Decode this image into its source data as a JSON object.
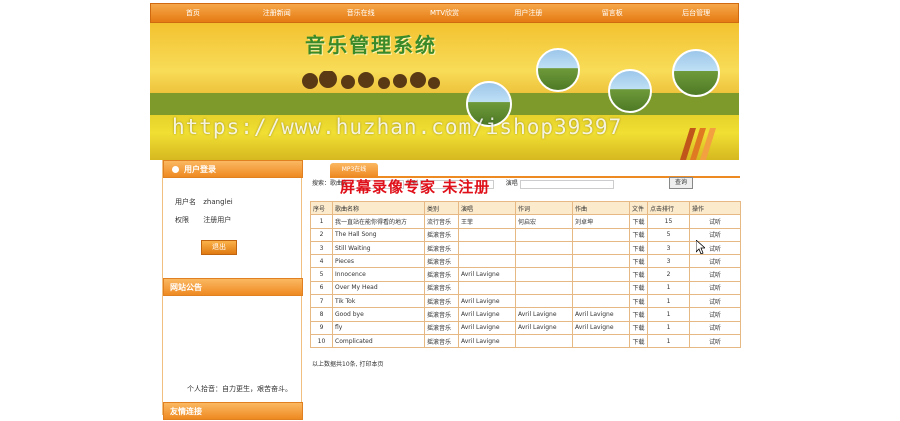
{
  "nav": [
    "首页",
    "注册新闻",
    "音乐在线",
    "MTV欣赏",
    "用户注册",
    "留言板",
    "后台管理"
  ],
  "banner": {
    "title": "音乐管理系统",
    "watermark_url": "https://www.huzhan.com/ishop39397"
  },
  "login_panel": {
    "title": "用户登录",
    "username_label": "用户名",
    "username": "zhanglei",
    "role_label": "权限",
    "role": "注册用户",
    "exit_button": "退出"
  },
  "notice_panel": {
    "title": "网站公告",
    "text": "个人拾音：自力更生，艰苦奋斗。"
  },
  "links_panel": {
    "title": "友情连接"
  },
  "main": {
    "tab": "MP3在线",
    "search_label_name": "搜索：歌曲名",
    "search_label_category": "类别",
    "search_label_singer": "演唱",
    "search_button": "查询",
    "watermark_cn": "屏幕录像专家 未注册",
    "columns": [
      "序号",
      "歌曲名称",
      "类别",
      "演唱",
      "作词",
      "作曲",
      "文件",
      "点击排行",
      "操作"
    ],
    "rows": [
      [
        "1",
        "我一直站在能你得看的地方",
        "流行音乐",
        "王菲",
        "何启宏",
        "刘卓坤",
        "下载",
        "15",
        "试听"
      ],
      [
        "2",
        "The Hall Song",
        "摇滚音乐",
        "",
        "",
        "",
        "下载",
        "5",
        "试听"
      ],
      [
        "3",
        "Still Waiting",
        "摇滚音乐",
        "",
        "",
        "",
        "下载",
        "3",
        "试听"
      ],
      [
        "4",
        "Pieces",
        "摇滚音乐",
        "",
        "",
        "",
        "下载",
        "3",
        "试听"
      ],
      [
        "5",
        "Innocence",
        "摇滚音乐",
        "Avril Lavigne",
        "",
        "",
        "下载",
        "2",
        "试听"
      ],
      [
        "6",
        "Over My Head",
        "摇滚音乐",
        "",
        "",
        "",
        "下载",
        "1",
        "试听"
      ],
      [
        "7",
        "Tik Tok",
        "摇滚音乐",
        "Avril Lavigne",
        "",
        "",
        "下载",
        "1",
        "试听"
      ],
      [
        "8",
        "Good bye",
        "摇滚音乐",
        "Avril Lavigne",
        "Avril Lavigne",
        "Avril Lavigne",
        "下载",
        "1",
        "试听"
      ],
      [
        "9",
        "fly",
        "摇滚音乐",
        "Avril Lavigne",
        "Avril Lavigne",
        "Avril Lavigne",
        "下载",
        "1",
        "试听"
      ],
      [
        "10",
        "Complicated",
        "摇滚音乐",
        "Avril Lavigne",
        "",
        "",
        "下载",
        "1",
        "试听"
      ]
    ],
    "footer": "以上数据共10条, 打印本页"
  },
  "colors": {
    "accent": "#ee8a22",
    "border": "#e6b884",
    "header_bg": "#fbeacb",
    "watermark_red": "#e0101a"
  },
  "icons": [
    "circle-bullet-icon",
    "mouse-cursor-icon"
  ]
}
